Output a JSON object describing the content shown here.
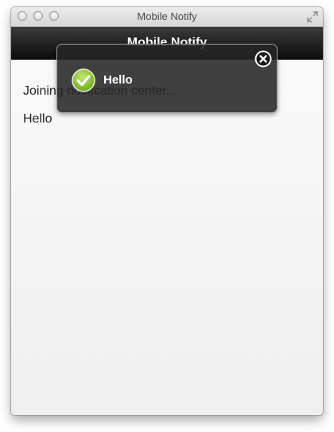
{
  "window": {
    "title": "Mobile Notify"
  },
  "app": {
    "header_title": "Mobile Notify"
  },
  "content": {
    "lines": [
      "Joining notification center...",
      "Hello"
    ]
  },
  "notification": {
    "message": "Hello",
    "status_icon": "check-circle-icon",
    "close_icon": "close-icon",
    "accent_color": "#8cc63f"
  }
}
